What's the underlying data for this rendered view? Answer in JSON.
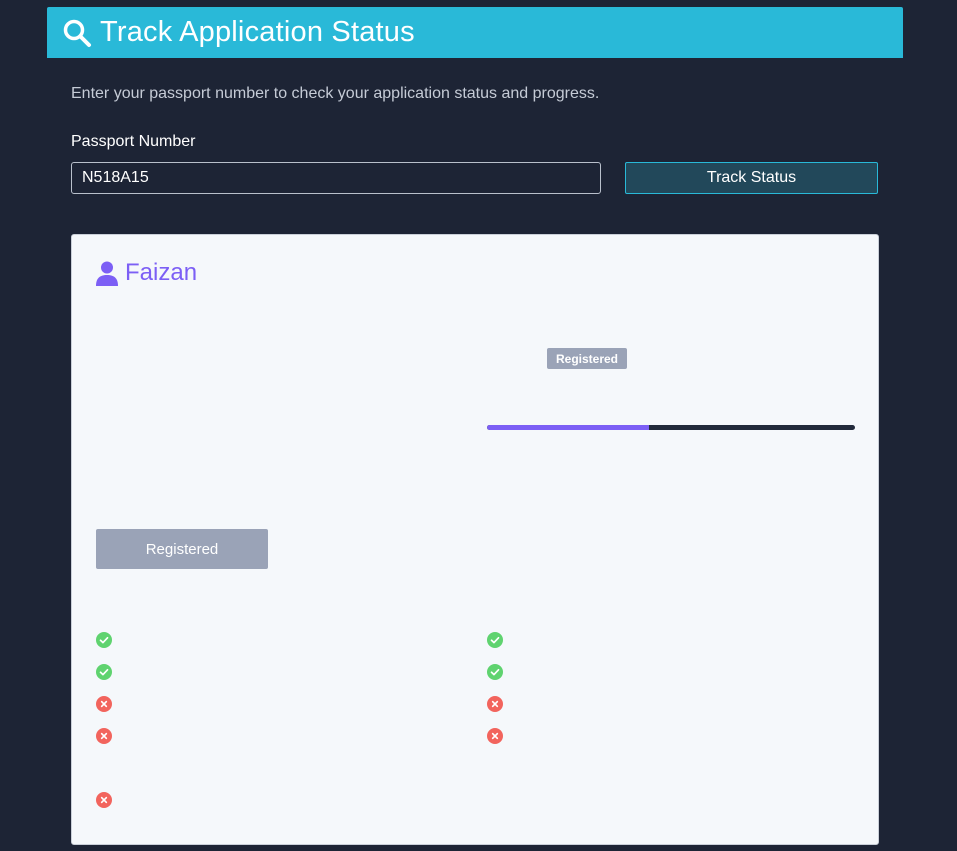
{
  "header": {
    "title": "Track Application Status",
    "icon": "search-icon"
  },
  "intro": {
    "description": "Enter your passport number to check your application status and progress."
  },
  "form": {
    "passport_label": "Passport Number",
    "passport_value": "N518A15",
    "submit_label": "Track Status"
  },
  "result": {
    "applicant_name": "Faizan",
    "applicant_icon": "user-icon",
    "status_badge": "Registered",
    "progress_fraction": 0.44,
    "status_button_label": "Registered",
    "left_checklist": [
      "pass",
      "pass",
      "fail",
      "fail",
      "fail"
    ],
    "right_checklist": [
      "pass",
      "pass",
      "fail",
      "fail"
    ]
  },
  "colors": {
    "header_bg": "#29b9d8",
    "page_bg": "#1d2435",
    "accent_purple": "#7c5ff5",
    "pass_green": "#5fd36f",
    "fail_red": "#f2645d",
    "badge_gray": "#9aa3b7"
  }
}
